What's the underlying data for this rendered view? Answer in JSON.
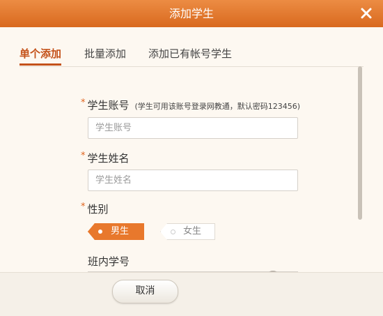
{
  "dialog": {
    "title": "添加学生",
    "close_icon": "close-icon"
  },
  "tabs": [
    {
      "label": "单个添加",
      "active": true
    },
    {
      "label": "批量添加",
      "active": false
    },
    {
      "label": "添加已有帐号学生",
      "active": false
    }
  ],
  "form": {
    "required_mark": "*",
    "account": {
      "label": "学生账号",
      "hint": "(学生可用该账号登录网教通，默认密码123456)",
      "placeholder": "学生账号",
      "value": ""
    },
    "name": {
      "label": "学生姓名",
      "placeholder": "学生姓名",
      "value": ""
    },
    "gender": {
      "label": "性别",
      "options": [
        "男生",
        "女生"
      ],
      "selected": "男生"
    },
    "class_number": {
      "label": "班内学号"
    }
  },
  "footer": {
    "cancel_label": "取消"
  },
  "colors": {
    "accent": "#e8782c",
    "title_bar": "#d9691f",
    "active_tab": "#c4521a",
    "background": "#fdf8f1"
  }
}
